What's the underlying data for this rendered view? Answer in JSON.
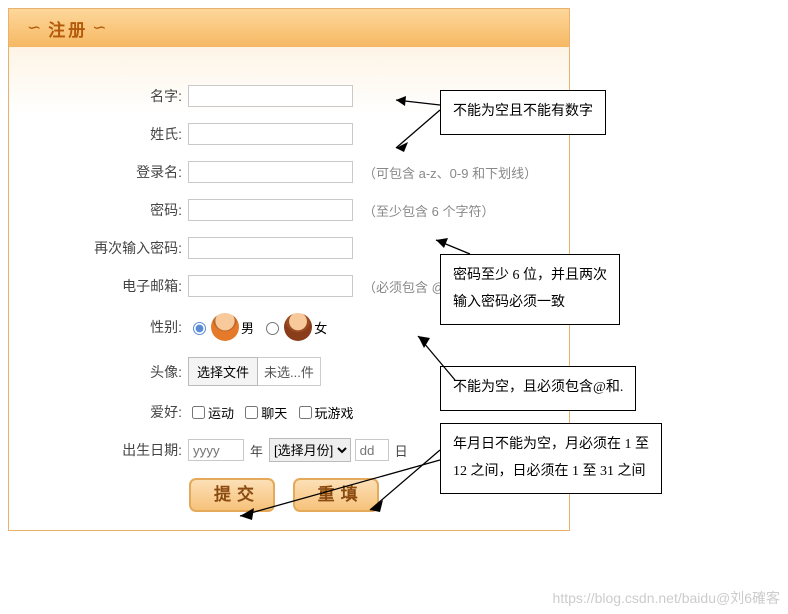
{
  "header": {
    "title": "注册"
  },
  "fields": {
    "name_label": "名字",
    "surname_label": "姓氏",
    "login_label": "登录名",
    "login_hint": "（可包含 a-z、0-9 和下划线）",
    "password_label": "密码",
    "password_hint": "（至少包含 6 个字符）",
    "password2_label": "再次输入密码",
    "email_label": "电子邮箱",
    "email_hint": "（必须包含 @ 字符）",
    "gender_label": "性别",
    "gender_male": "男",
    "gender_female": "女",
    "avatar_label": "头像",
    "file_button": "选择文件",
    "file_status": "未选...件",
    "hobby_label": "爱好",
    "hobby_sport": "运动",
    "hobby_chat": "聊天",
    "hobby_game": "玩游戏",
    "dob_label": "出生日期",
    "year_placeholder": "yyyy",
    "year_suffix": "年",
    "month_placeholder": "[选择月份]",
    "day_placeholder": "dd",
    "day_suffix": "日"
  },
  "buttons": {
    "submit": "提交",
    "reset": "重填"
  },
  "notes": {
    "name": "不能为空且不能有数字",
    "password_l1": "密码至少 6 位，并且两次",
    "password_l2": "输入密码必须一致",
    "email": "不能为空，且必须包含@和.",
    "dob_l1": "年月日不能为空，月必须在 1 至",
    "dob_l2": "12 之间，日必须在 1 至 31 之间"
  },
  "watermark": "https://blog.csdn.net/baidu@刘6確客"
}
